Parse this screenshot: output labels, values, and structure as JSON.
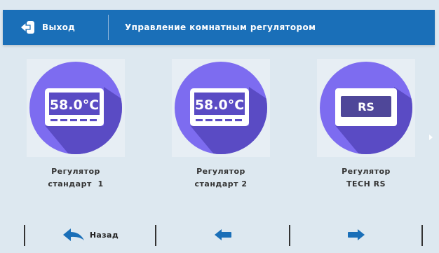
{
  "header": {
    "exit_label": "Выход",
    "title": "Управление комнатным регулятором"
  },
  "tiles": [
    {
      "display": "58.0°C",
      "label_line1": "Регулятор",
      "label_line2": "стандарт  1"
    },
    {
      "display": "58.0°C",
      "label_line1": "Регулятор",
      "label_line2": "стандарт 2"
    },
    {
      "display": "RS",
      "label_line1": "Регулятор",
      "label_line2": "TECH RS"
    }
  ],
  "footer": {
    "back_label": "Назад"
  },
  "colors": {
    "header_bg": "#1a6fb8",
    "circle": "#7d6cf0",
    "circle_dark": "#5a4bc4",
    "screen_bg": "#dde8f0",
    "icon_blue": "#1a6fb8"
  }
}
